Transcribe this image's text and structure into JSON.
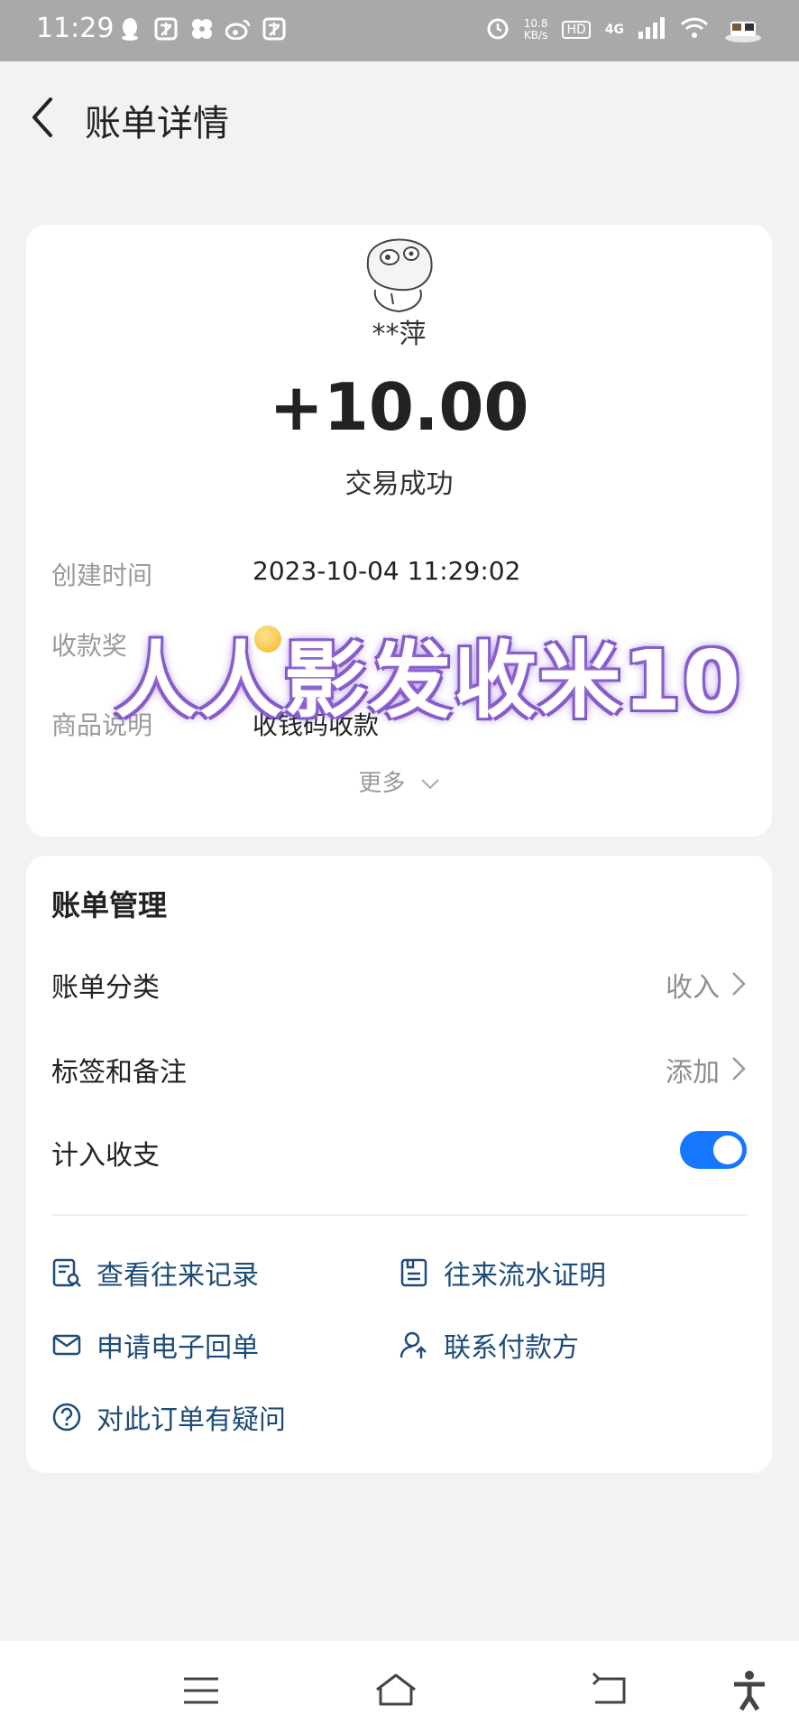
{
  "status_bar": {
    "time": "11:29",
    "left_icons": [
      "qq-icon",
      "app-icon",
      "fan-icon",
      "weibo-icon",
      "app-icon"
    ],
    "speed_value": "10.8",
    "speed_unit": "KB/s",
    "hd": "HD",
    "network": "4G",
    "right_icons": [
      "alarm-icon",
      "signal-icon",
      "wifi-icon",
      "avatar-icon"
    ]
  },
  "header": {
    "title": "账单详情",
    "back_icon": "back-chevron-icon"
  },
  "transaction": {
    "payer": "**萍",
    "amount": "+10.00",
    "status": "交易成功",
    "details": [
      {
        "label": "创建时间",
        "value": "2023-10-04 11:29:02"
      },
      {
        "label": "收款奖",
        "value": ""
      },
      {
        "label": "商品说明",
        "value": "收钱码收款"
      }
    ],
    "more": "更多",
    "watermark": "人人影发收米10"
  },
  "bill_management": {
    "title": "账单管理",
    "rows": [
      {
        "label": "账单分类",
        "value": "收入"
      },
      {
        "label": "标签和备注",
        "value": "添加"
      },
      {
        "label": "计入收支",
        "toggle_on": true
      }
    ],
    "actions": [
      {
        "label": "查看往来记录",
        "icon": "record-search-icon"
      },
      {
        "label": "往来流水证明",
        "icon": "statement-icon"
      },
      {
        "label": "申请电子回单",
        "icon": "mail-icon"
      },
      {
        "label": "联系付款方",
        "icon": "contact-user-icon"
      },
      {
        "label": "对此订单有疑问",
        "icon": "question-icon"
      }
    ]
  },
  "colors": {
    "accent": "#1677ff",
    "link": "#1d4c7a",
    "background": "#f2f2f4"
  },
  "nav_bar": [
    "menu-icon",
    "home-icon",
    "back-icon",
    "accessibility-icon"
  ]
}
